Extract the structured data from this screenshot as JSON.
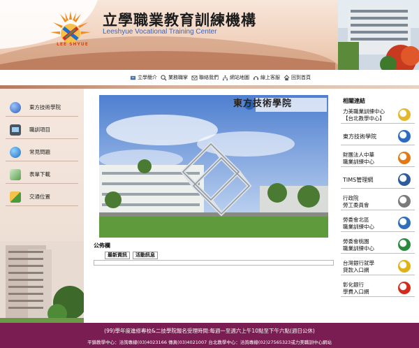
{
  "header": {
    "title_zh": "立學職業教育訓練機構",
    "title_en": "Leeshyue Vocational Training Center",
    "logo_caption": "LEE SHYUE"
  },
  "topnav": {
    "items": [
      {
        "label": "立學簡介",
        "icon": "info-icon"
      },
      {
        "label": "業務職掌",
        "icon": "search-icon"
      },
      {
        "label": "聯絡我們",
        "icon": "contact-icon"
      },
      {
        "label": "網站地圖",
        "icon": "sitemap-icon"
      },
      {
        "label": "線上客服",
        "icon": "headset-icon"
      },
      {
        "label": "回到首頁",
        "icon": "home-icon"
      }
    ]
  },
  "sidebar": {
    "items": [
      {
        "label": "東方技術學院",
        "icon": "globe-icon"
      },
      {
        "label": "職訓項目",
        "icon": "monitor-icon"
      },
      {
        "label": "常見問題",
        "icon": "question-icon"
      },
      {
        "label": "表單下載",
        "icon": "download-icon"
      },
      {
        "label": "交通位置",
        "icon": "map-icon"
      }
    ]
  },
  "main": {
    "photo_caption": "東方技術學院",
    "bulletin_heading": "公佈欄",
    "tabs": [
      "最新資訊",
      "活動訊息"
    ]
  },
  "links": {
    "heading": "相關連結",
    "items": [
      {
        "lines": [
          "力美職業訓練中心",
          "【台北教學中心】"
        ],
        "icon": "liwei-logo",
        "color": "#e3b92b"
      },
      {
        "lines": [
          "東方技術學院"
        ],
        "icon": "tf-logo",
        "color": "#2b6bc0"
      },
      {
        "lines": [
          "財團法人中華",
          "職業訓練中心"
        ],
        "icon": "chvt-logo",
        "color": "#e07a14"
      },
      {
        "lines": [
          "TIMS管理網"
        ],
        "icon": "tims-logo",
        "color": "#2e5c9a"
      },
      {
        "lines": [
          "行政院",
          "勞工委員會"
        ],
        "icon": "cla-logo",
        "color": "#7a7a7a"
      },
      {
        "lines": [
          "勞委會北區",
          "職業訓練中心"
        ],
        "icon": "north-center-logo",
        "color": "#2f6fb8"
      },
      {
        "lines": [
          "勞委會桃園",
          "職業訓練中心"
        ],
        "icon": "taoyuan-center-logo",
        "color": "#2a8a3c"
      },
      {
        "lines": [
          "台灣銀行就學",
          "貸款入口網"
        ],
        "icon": "bot-logo",
        "color": "#e0b315"
      },
      {
        "lines": [
          "彰化銀行",
          "學費入口網"
        ],
        "icon": "chb-logo",
        "color": "#d42a1e"
      }
    ]
  },
  "footer": {
    "line1": "(99)學年度進修專校&二技學院報名受理時間:每週一至週六上午10點至下午六點(週日公休)",
    "line2": "平鎮教學中心：洽詢專線(03)4023166 傳真(03)4021007 台北教學中心：洽詢專線(02)27565323或力美職訓中心網站"
  }
}
